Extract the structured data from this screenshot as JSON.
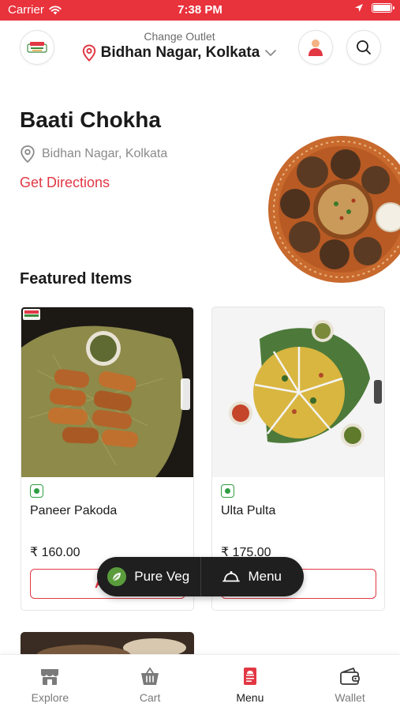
{
  "status_bar": {
    "carrier": "Carrier",
    "time": "7:38 PM"
  },
  "header": {
    "change_outlet_label": "Change Outlet",
    "outlet_name": "Bidhan Nagar, Kolkata",
    "icons": [
      "logo-icon",
      "location-pin-icon",
      "chevron-down-icon",
      "profile-icon",
      "search-icon"
    ]
  },
  "restaurant": {
    "name": "Baati Chokha",
    "location": "Bidhan Nagar, Kolkata",
    "directions_label": "Get Directions"
  },
  "featured": {
    "title": "Featured Items",
    "items": [
      {
        "name": "Paneer Pakoda",
        "price": "₹ 160.00",
        "add_label": "Add",
        "veg": true
      },
      {
        "name": "Ulta Pulta",
        "price": "₹ 175.00",
        "add_label": "+",
        "veg": true
      }
    ]
  },
  "filter_pill": {
    "pure_veg_label": "Pure Veg",
    "menu_label": "Menu"
  },
  "bottom_nav": {
    "items": [
      {
        "label": "Explore",
        "icon": "store-icon"
      },
      {
        "label": "Cart",
        "icon": "basket-icon"
      },
      {
        "label": "Menu",
        "icon": "menu-book-icon"
      },
      {
        "label": "Wallet",
        "icon": "wallet-icon"
      }
    ],
    "active": "Menu"
  },
  "colors": {
    "brand_red": "#e23744",
    "status_bar": "#e8323c",
    "veg_green": "#2e9e44",
    "pill_bg": "#1f1f1f"
  }
}
